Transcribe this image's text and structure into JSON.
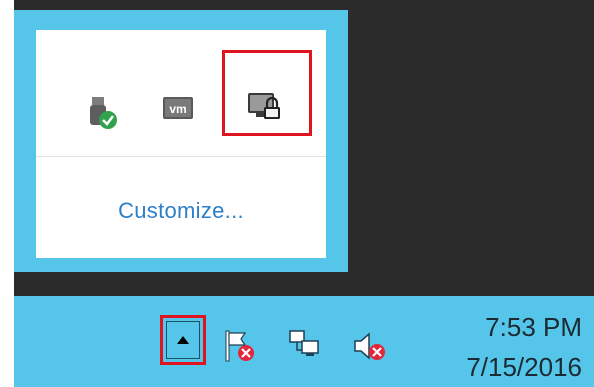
{
  "overflow_popup": {
    "icons": [
      "usb-safely-remove-icon",
      "vmware-tools-icon",
      "remote-lock-icon"
    ],
    "customize_label": "Customize..."
  },
  "taskbar": {
    "overflow_button_icon": "triangle-up-icon",
    "icons": [
      "action-center-flag-icon",
      "network-icon",
      "volume-muted-icon"
    ],
    "clock": {
      "time": "7:53 PM",
      "date": "7/15/2016"
    }
  },
  "colors": {
    "taskbar": "#55c6e9",
    "link": "#2d7fc7",
    "highlight": "#e0141e",
    "desktop": "#2b2b2b"
  }
}
